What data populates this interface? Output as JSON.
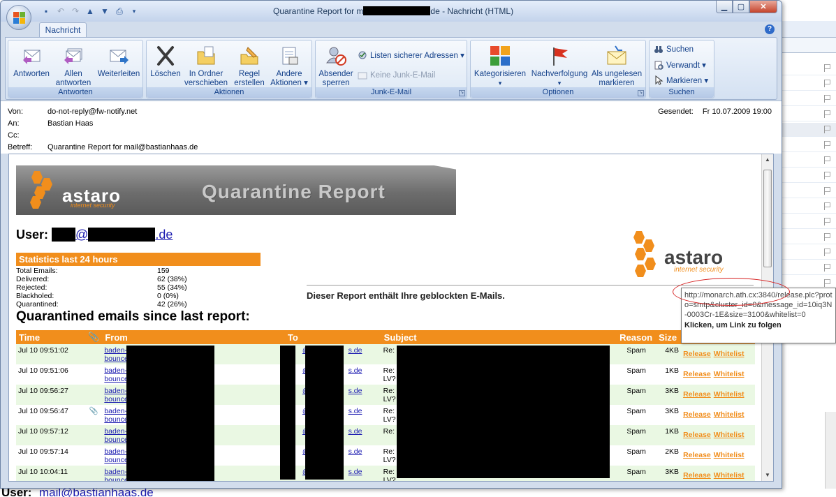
{
  "window": {
    "title_prefix": "Quarantine Report for m",
    "title_suffix": "de - Nachricht (HTML)",
    "buttons": {
      "minimize": "▁",
      "maximize": "▢",
      "close": "✕"
    }
  },
  "tab": {
    "label": "Nachricht"
  },
  "ribbon": {
    "groups": {
      "antworten": "Antworten",
      "aktionen": "Aktionen",
      "junk": "Junk-E-Mail",
      "optionen": "Optionen",
      "suchen": "Suchen"
    },
    "buttons": {
      "antworten": "Antworten",
      "allen_1": "Allen",
      "allen_2": "antworten",
      "weiterleiten": "Weiterleiten",
      "loeschen": "Löschen",
      "ordner_1": "In Ordner",
      "ordner_2": "verschieben ▾",
      "regel_1": "Regel",
      "regel_2": "erstellen",
      "andere_1": "Andere",
      "andere_2": "Aktionen ▾",
      "absender_1": "Absender",
      "absender_2": "sperren",
      "listen": "Listen sicherer Adressen ▾",
      "keine_junk": "Keine Junk-E-Mail",
      "kategorisieren": "Kategorisieren",
      "nachverfolgung": "Nachverfolgung",
      "ungelesen_1": "Als ungelesen",
      "ungelesen_2": "markieren",
      "suchen": "Suchen",
      "verwandt": "Verwandt ▾",
      "markieren": "Markieren ▾"
    }
  },
  "header": {
    "von_label": "Von:",
    "von": "do-not-reply@fw-notify.net",
    "an_label": "An:",
    "an": "Bastian Haas",
    "cc_label": "Cc:",
    "cc": "",
    "betreff_label": "Betreff:",
    "betreff": "Quarantine Report for mail@bastianhaas.de",
    "gesendet_label": "Gesendet:",
    "gesendet": "Fr 10.07.2009 19:00"
  },
  "report": {
    "banner_brand": "astaro",
    "banner_sub": "internet security",
    "banner_title": "Quarantine Report",
    "user_label": "User:",
    "user_email_at": "@",
    "user_email_tld": ".de",
    "logo_brand": "astaro",
    "logo_sub": "internet security",
    "stats_title": "Statistics last 24 hours",
    "stats": [
      {
        "k": "Total Emails:",
        "v": "159"
      },
      {
        "k": "Delivered:",
        "v": "62 (38%)"
      },
      {
        "k": "Rejected:",
        "v": "55 (34%)"
      },
      {
        "k": "Blackholed:",
        "v": "0 (0%)"
      },
      {
        "k": "Quarantined:",
        "v": "42 (26%)"
      }
    ],
    "notice": "Dieser Report enthält Ihre geblockten E-Mails.",
    "quarantined_heading": "Quarantined emails since last report:",
    "columns": {
      "time": "Time",
      "from": "From",
      "to": "To",
      "subject": "Subject",
      "reason": "Reason",
      "size": "Size"
    },
    "rows": [
      {
        "time": "Jul 10 09:51:02",
        "attach": false,
        "from1": "baden-w",
        "from2": "bounces",
        "to_domain": "s.de",
        "subj1": "Re: [",
        "subj2": "",
        "reason": "Spam",
        "size": "4KB"
      },
      {
        "time": "Jul 10 09:51:06",
        "attach": false,
        "from1": "baden-w",
        "from2": "bounces",
        "to_domain": "s.de",
        "subj1": "Re: [",
        "subj2": "LV?",
        "reason": "Spam",
        "size": "1KB"
      },
      {
        "time": "Jul 10 09:56:27",
        "attach": false,
        "from1": "baden-w",
        "from2": "bounces",
        "to_domain": "s.de",
        "subj1": "Re: [",
        "subj2": "LV?",
        "reason": "Spam",
        "size": "3KB"
      },
      {
        "time": "Jul 10 09:56:47",
        "attach": true,
        "from1": "baden-w",
        "from2": "bounces",
        "to_domain": "s.de",
        "subj1": "Re: [",
        "subj2": "LV?",
        "reason": "Spam",
        "size": "3KB"
      },
      {
        "time": "Jul 10 09:57:12",
        "attach": false,
        "from1": "baden-w",
        "from2": "bounces",
        "to_domain": "s.de",
        "subj1": "Re: [",
        "subj2": "",
        "reason": "Spam",
        "size": "1KB"
      },
      {
        "time": "Jul 10 09:57:14",
        "attach": false,
        "from1": "baden-w",
        "from2": "bounces",
        "to_domain": "s.de",
        "subj1": "Re: [",
        "subj2": "LV?",
        "reason": "Spam",
        "size": "2KB"
      },
      {
        "time": "Jul 10 10:04:11",
        "attach": false,
        "from1": "baden-w",
        "from2": "bounces",
        "to_domain": "s.de",
        "subj1": "Re: [",
        "subj2": "LV?",
        "reason": "Spam",
        "size": "3KB"
      }
    ],
    "release_label": "Release",
    "whitelist_label": "Whitelist"
  },
  "tooltip": {
    "url": "http://monarch.ath.cx:3840/release.plc?proto=smtp&cluster_id=0&message_id=10iq3N-0003Cr-1E&size=3100&whitelist=0",
    "cta": "Klicken, um Link zu folgen"
  },
  "background": {
    "user_label": "User:",
    "user_email": "mail@bastianhaas.de"
  },
  "colors": {
    "accent": "#f18e1c",
    "row_alt": "#eaf8e3",
    "link": "#1a1ab0"
  }
}
